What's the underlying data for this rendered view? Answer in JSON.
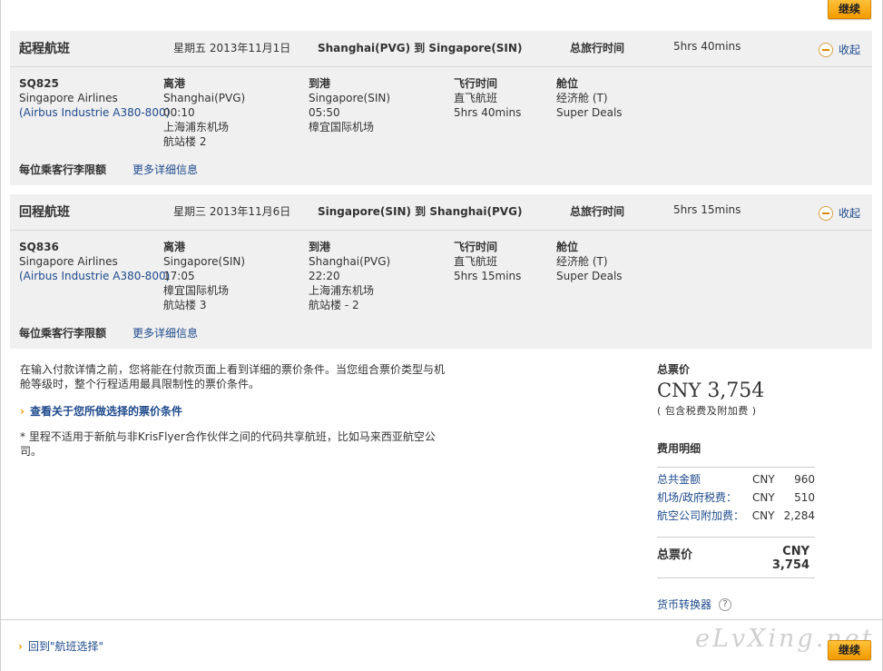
{
  "buttons": {
    "continue": "继续"
  },
  "outbound": {
    "title": "起程航班",
    "date": "星期五 2013年11月1日",
    "route": "Shanghai(PVG) 到 Singapore(SIN)",
    "total_time_label": "总旅行时间",
    "total_time": "5hrs 40mins",
    "collapse": "收起",
    "flight_no": "SQ825",
    "airline": "Singapore Airlines",
    "aircraft": "(Airbus Industrie A380-800)",
    "depart_label": "离港",
    "depart_city": "Shanghai(PVG)",
    "depart_time": "00:10",
    "depart_airport": "上海浦东机场",
    "depart_terminal": "航站楼 2",
    "arrive_label": "到港",
    "arrive_city": "Singapore(SIN)",
    "arrive_time": "05:50",
    "arrive_airport": "樟宜国际机场",
    "arrive_terminal": "",
    "flighttime_label": "飞行时间",
    "nonstop": "直飞航班",
    "duration": "5hrs 40mins",
    "cabin_label": "舱位",
    "cabin": "经济舱 (T)",
    "fare": "Super Deals",
    "baggage": "每位乘客行李限额",
    "more": "更多详细信息"
  },
  "inbound": {
    "title": "回程航班",
    "date": "星期三 2013年11月6日",
    "route": "Singapore(SIN) 到 Shanghai(PVG)",
    "total_time_label": "总旅行时间",
    "total_time": "5hrs 15mins",
    "collapse": "收起",
    "flight_no": "SQ836",
    "airline": "Singapore Airlines",
    "aircraft": "(Airbus Industrie A380-800)",
    "depart_label": "离港",
    "depart_city": "Singapore(SIN)",
    "depart_time": "17:05",
    "depart_airport": "樟宜国际机场",
    "depart_terminal": "航站楼 3",
    "arrive_label": "到港",
    "arrive_city": "Shanghai(PVG)",
    "arrive_time": "22:20",
    "arrive_airport": "上海浦东机场",
    "arrive_terminal": "航站楼 - 2",
    "flighttime_label": "飞行时间",
    "nonstop": "直飞航班",
    "duration": "5hrs 15mins",
    "cabin_label": "舱位",
    "cabin": "经济舱 (T)",
    "fare": "Super Deals",
    "baggage": "每位乘客行李限额",
    "more": "更多详细信息"
  },
  "notes": {
    "intro": "在输入付款详情之前，您将能在付款页面上看到详细的票价条件。当您组合票价类型与机舱等级时，整个行程适用最具限制性的票价条件。",
    "fare_conditions_link": "查看关于您所做选择的票价条件",
    "miles_note": "* 里程不适用于新航与非KrisFlyer合作伙伴之间的代码共享航班，比如马来西亚航空公司。"
  },
  "price": {
    "total_label": "总票价",
    "currency": "CNY",
    "amount": "3,754",
    "incl": "( 包含税费及附加费 )",
    "breakdown_title": "费用明细",
    "rows": [
      {
        "name": "总共金额",
        "cur": "CNY",
        "value": "960"
      },
      {
        "name": "机场/政府税费：",
        "cur": "CNY",
        "value": "510"
      },
      {
        "name": "航空公司附加费：",
        "cur": "CNY",
        "value": "2,284"
      }
    ],
    "final_label": "总票价",
    "final_value": "CNY 3,754",
    "converter": "货币转换器"
  },
  "footer": {
    "back": "回到\"航班选择\"",
    "watermark": "eLvXing.net"
  }
}
